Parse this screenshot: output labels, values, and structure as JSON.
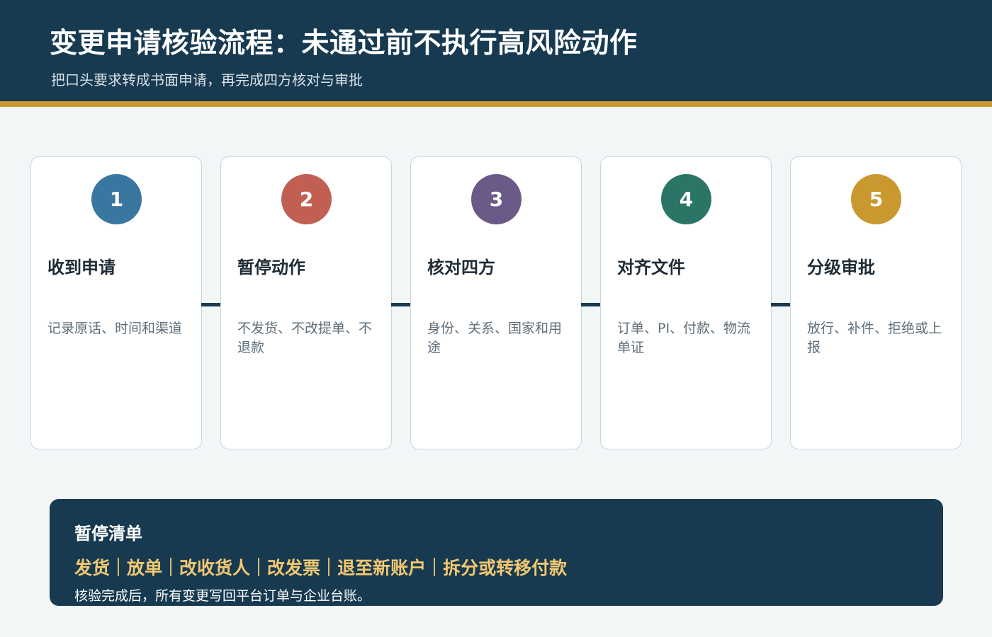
{
  "header": {
    "title": "变更申请核验流程：未通过前不执行高风险动作",
    "subtitle": "把口头要求转成书面申请，再完成四方核对与审批"
  },
  "steps": [
    {
      "number": "1",
      "title": "收到申请",
      "desc": "记录原话、时间和渠道",
      "color": "#3a77a0"
    },
    {
      "number": "2",
      "title": "暂停动作",
      "desc": "不发货、不改提单、不退款",
      "color": "#c05f52"
    },
    {
      "number": "3",
      "title": "核对四方",
      "desc": "身份、关系、国家和用途",
      "color": "#6a5a88"
    },
    {
      "number": "4",
      "title": "对齐文件",
      "desc": "订单、PI、付款、物流单证",
      "color": "#2b7567"
    },
    {
      "number": "5",
      "title": "分级审批",
      "desc": "放行、补件、拒绝或上报",
      "color": "#c9992f"
    }
  ],
  "pause": {
    "title": "暂停清单",
    "items": [
      "发货",
      "放单",
      "改收货人",
      "改发票",
      "退至新账户",
      "拆分或转移付款"
    ],
    "note": "核验完成后，所有变更写回平台订单与企业台账。"
  },
  "colors": {
    "header_bg": "#173a50",
    "accent": "#c9992f",
    "highlight": "#f2c871"
  }
}
